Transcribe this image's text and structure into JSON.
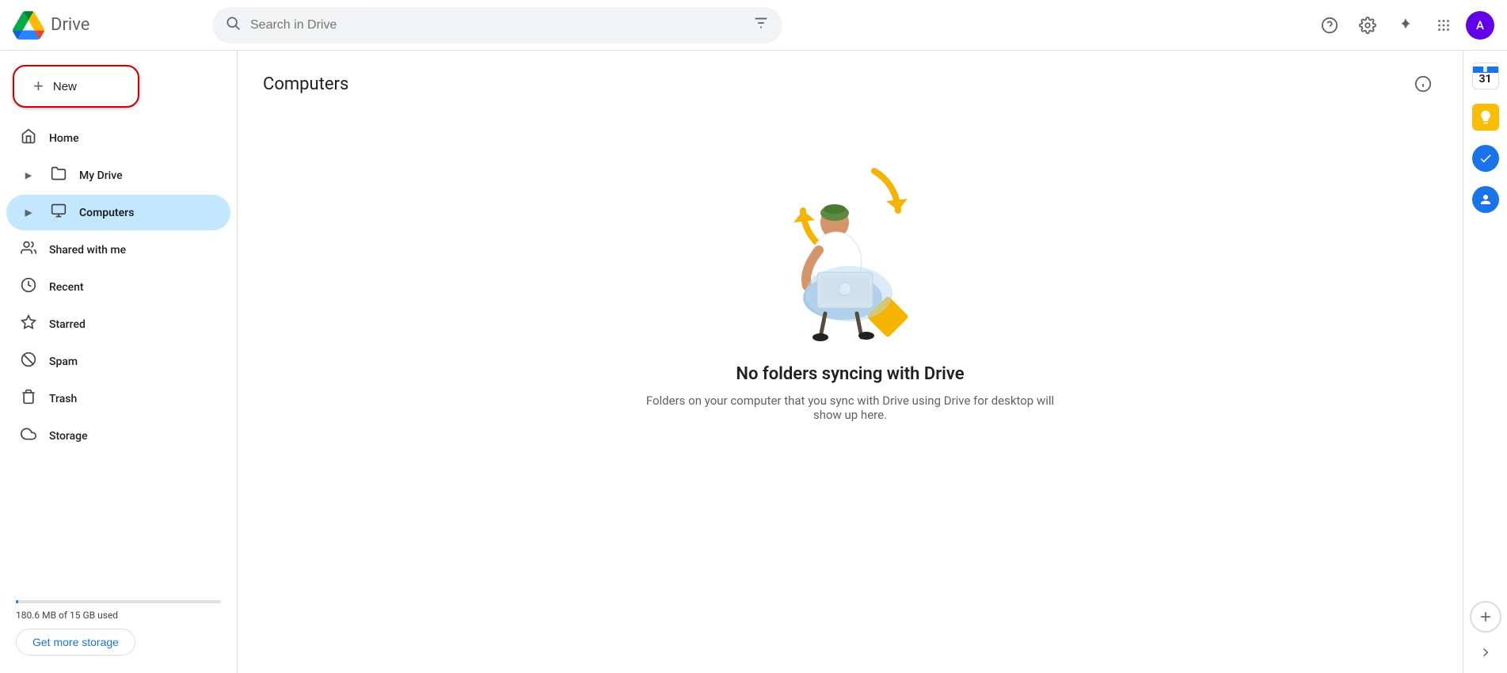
{
  "header": {
    "logo_text": "Drive",
    "search_placeholder": "Search in Drive",
    "avatar_letter": "A"
  },
  "sidebar": {
    "new_button_label": "New",
    "nav_items": [
      {
        "id": "home",
        "label": "Home",
        "icon": "🏠",
        "active": false,
        "has_arrow": false
      },
      {
        "id": "my-drive",
        "label": "My Drive",
        "icon": "📁",
        "active": false,
        "has_arrow": true
      },
      {
        "id": "computers",
        "label": "Computers",
        "icon": "🖥",
        "active": true,
        "has_arrow": true
      },
      {
        "id": "shared-with-me",
        "label": "Shared with me",
        "icon": "👥",
        "active": false,
        "has_arrow": false
      },
      {
        "id": "recent",
        "label": "Recent",
        "icon": "🕐",
        "active": false,
        "has_arrow": false
      },
      {
        "id": "starred",
        "label": "Starred",
        "icon": "⭐",
        "active": false,
        "has_arrow": false
      },
      {
        "id": "spam",
        "label": "Spam",
        "icon": "🚫",
        "active": false,
        "has_arrow": false
      },
      {
        "id": "trash",
        "label": "Trash",
        "icon": "🗑",
        "active": false,
        "has_arrow": false
      },
      {
        "id": "storage",
        "label": "Storage",
        "icon": "☁",
        "active": false,
        "has_arrow": false
      }
    ],
    "storage": {
      "used_text": "180.6 MB of 15 GB used",
      "get_storage_label": "Get more storage",
      "percent": 1.2
    }
  },
  "main": {
    "page_title": "Computers",
    "empty_state": {
      "title": "No folders syncing with Drive",
      "subtitle": "Folders on your computer that you sync with Drive using Drive for desktop will show up here."
    }
  },
  "right_rail": {
    "apps": [
      {
        "id": "calendar",
        "label": "31"
      },
      {
        "id": "keep",
        "label": "💡"
      },
      {
        "id": "tasks",
        "label": "✓"
      },
      {
        "id": "contacts",
        "label": "👤"
      }
    ],
    "add_label": "+",
    "chevron_label": "›"
  }
}
